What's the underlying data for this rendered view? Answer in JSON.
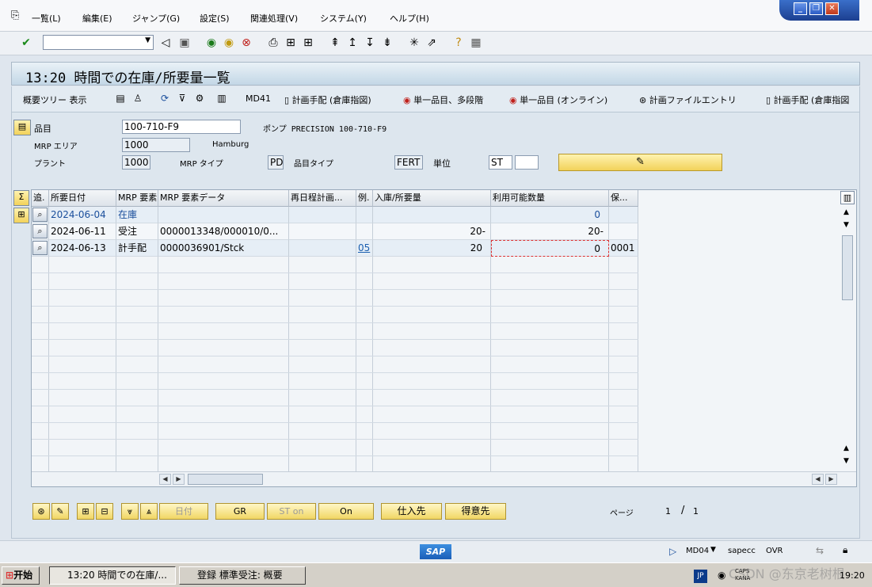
{
  "menu": [
    "一覧(L)",
    "編集(E)",
    "ジャンプ(G)",
    "設定(S)",
    "関連処理(V)",
    "システム(Y)",
    "ヘルプ(H)"
  ],
  "window_controls": {
    "minimize": "_",
    "restore": "❐",
    "close": "✕"
  },
  "title": "13:20 時間での在庫/所要量一覧",
  "app_toolbar": {
    "overview_tree": "概要ツリー 表示",
    "md41": "MD41",
    "plan_order_warehouse": "計画手配 (倉庫指図)",
    "single_item_multilevel": "単一品目、多段階",
    "single_item_online": "単一品目 (オンライン)",
    "plan_file_entry": "計画ファイルエントリ",
    "plan_order_warehouse2": "計画手配 (倉庫指図"
  },
  "header": {
    "material_label": "品目",
    "material_value": "100-710-F9",
    "material_desc": "ポンプ PRECISION 100-710-F9",
    "mrp_area_label": "MRP エリア",
    "mrp_area_value": "1000",
    "mrp_area_desc": "Hamburg",
    "plant_label": "プラント",
    "plant_value": "1000",
    "mrp_type_label": "MRP タイプ",
    "mrp_type_value": "PD",
    "material_type_label": "品目タイプ",
    "material_type_value": "FERT",
    "unit_label": "単位",
    "unit_value": "ST"
  },
  "grid": {
    "columns": [
      "追.",
      "所要日付",
      "MRP 要素",
      "MRP 要素データ",
      "再日程計画...",
      "例.",
      "入庫/所要量",
      "利用可能数量",
      "保..."
    ],
    "rows": [
      {
        "date": "2024-06-04",
        "element": "在庫",
        "data": "",
        "resched": "",
        "ex": "",
        "qty": "",
        "avail": "0",
        "stor": ""
      },
      {
        "date": "2024-06-11",
        "element": "受注",
        "data": "0000013348/000010/0...",
        "resched": "",
        "ex": "",
        "qty": "20-",
        "avail": "20-",
        "stor": ""
      },
      {
        "date": "2024-06-13",
        "element": "計手配",
        "data": "0000036901/Stck",
        "resched": "",
        "ex": "05",
        "qty": "20",
        "avail": "0",
        "stor": "0001"
      }
    ]
  },
  "bottom_buttons": {
    "date": "日付",
    "gr": "GR",
    "st_on": "ST on",
    "on": "On",
    "vendor": "仕入先",
    "customer": "得意先"
  },
  "paging": {
    "label": "ページ",
    "current": "1",
    "sep": "/",
    "total": "1"
  },
  "status": {
    "sap_logo": "SAP",
    "tcode": "MD04",
    "server": "sapecc",
    "mode": "OVR"
  },
  "taskbar": {
    "start": "开始",
    "task1": "13:20 時間での在庫/...",
    "task2": "登録 標準受注: 概要",
    "lang": "JP",
    "ime": "CAPS KANA",
    "watermark": "CSDN @东京老树根",
    "clock": "19:20"
  }
}
